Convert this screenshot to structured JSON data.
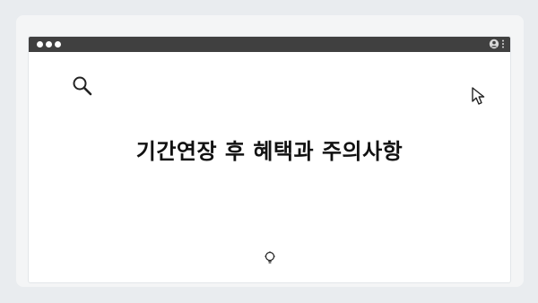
{
  "pager": {
    "dots": [
      "page-1",
      "page-2",
      "page-3",
      "page-4"
    ]
  },
  "window": {
    "titlebar": {
      "controls": [
        "close",
        "minimize",
        "maximize"
      ],
      "right_icons": [
        "user-icon",
        "more-vert-icon"
      ]
    }
  },
  "content": {
    "headline": "기간연장 후 혜택과 주의사항",
    "decor_icons": [
      "search-icon",
      "cursor-icon",
      "lightbulb-icon"
    ]
  },
  "colors": {
    "background": "#e9ecef",
    "titlebar": "#404040",
    "text": "#111111"
  }
}
